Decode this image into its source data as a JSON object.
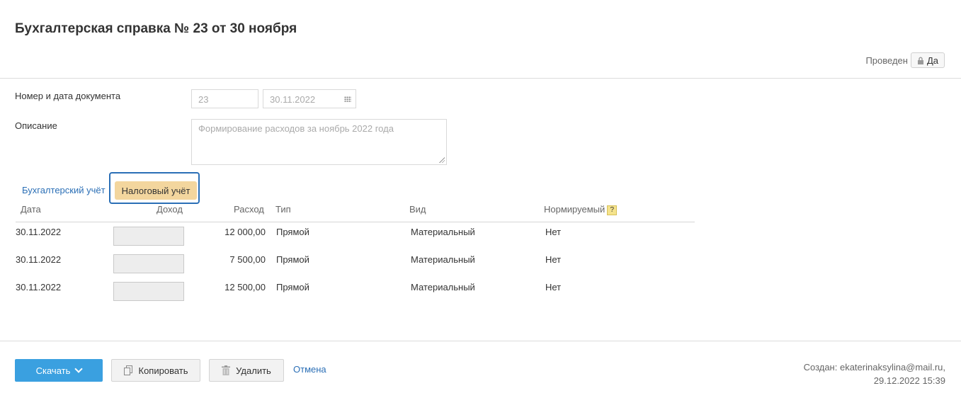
{
  "header": {
    "title": "Бухгалтерская справка № 23 от 30 ноября",
    "posted_label": "Проведен",
    "posted_value": "Да"
  },
  "form": {
    "doc_label": "Номер и дата документа",
    "doc_number": "23",
    "doc_date": "30.11.2022",
    "description_label": "Описание",
    "description_value": "Формирование расходов за ноябрь 2022 года"
  },
  "tabs": [
    {
      "label": "Бухгалтерский учёт",
      "active": false
    },
    {
      "label": "Налоговый учёт",
      "active": true
    }
  ],
  "table": {
    "columns": [
      "Дата",
      "Доход",
      "Расход",
      "Тип",
      "Вид",
      "Нормируемый"
    ],
    "help_badge": "?",
    "rows": [
      {
        "date": "30.11.2022",
        "income": "",
        "expense": "12 000,00",
        "type": "Прямой",
        "kind": "Материальный",
        "normed": "Нет"
      },
      {
        "date": "30.11.2022",
        "income": "",
        "expense": "7 500,00",
        "type": "Прямой",
        "kind": "Материальный",
        "normed": "Нет"
      },
      {
        "date": "30.11.2022",
        "income": "",
        "expense": "12 500,00",
        "type": "Прямой",
        "kind": "Материальный",
        "normed": "Нет"
      }
    ]
  },
  "footer": {
    "download_label": "Скачать",
    "copy_label": "Копировать",
    "delete_label": "Удалить",
    "cancel_label": "Отмена",
    "created_line1": "Создан: ekaterinaksylina@mail.ru,",
    "created_line2": "29.12.2022 15:39"
  },
  "colors": {
    "accent": "#3aa0e0",
    "link": "#2b6fb6",
    "active_tab": "#f3d69e"
  }
}
